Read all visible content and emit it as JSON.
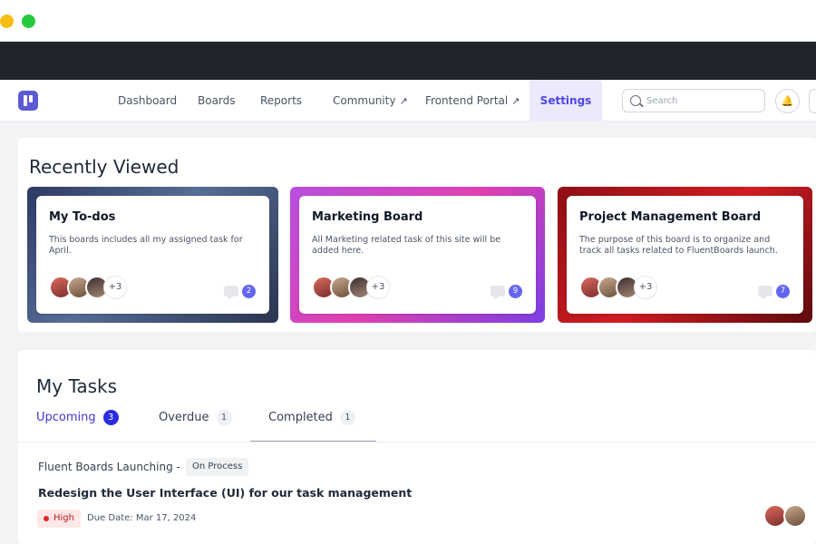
{
  "colors": {
    "accent": "#4f46e5",
    "dark_bar": "#20242b",
    "traffic_yellow": "#f6bd16",
    "traffic_green": "#27c93f"
  },
  "nav": {
    "logo_icon": "fluentboards-logo-icon",
    "items": [
      {
        "label": "Dashboard"
      },
      {
        "label": "Boards"
      },
      {
        "label": "Reports"
      },
      {
        "label": "Community",
        "external": "↗"
      },
      {
        "label": "Frontend Portal",
        "external": "↗"
      },
      {
        "label": "Settings",
        "active": true
      }
    ],
    "search_placeholder": "Search",
    "bell_icon": "bell-icon"
  },
  "recently_viewed": {
    "title": "Recently Viewed",
    "boards": [
      {
        "title": "My To-dos",
        "description": "This boards includes all my assigned task for April.",
        "more_members": "+3",
        "comments": "2"
      },
      {
        "title": "Marketing Board",
        "description": "All Marketing related task of this site will be added here.",
        "more_members": "+3",
        "comments": "9"
      },
      {
        "title": "Project Management Board",
        "description": "The purpose of this board is to organize and track all tasks related to FluentBoards launch.",
        "more_members": "+3",
        "comments": "7"
      }
    ]
  },
  "my_tasks": {
    "title": "My Tasks",
    "tabs": [
      {
        "label": "Upcoming",
        "count": "3",
        "active": true
      },
      {
        "label": "Overdue",
        "count": "1"
      },
      {
        "label": "Completed",
        "count": "1"
      }
    ],
    "task": {
      "board": "Fluent Boards Launching",
      "separator": "-",
      "status": "On Process",
      "title": "Redesign the User Interface (UI) for our task management",
      "priority": "High",
      "due": "Due Date: Mar 17, 2024"
    }
  }
}
